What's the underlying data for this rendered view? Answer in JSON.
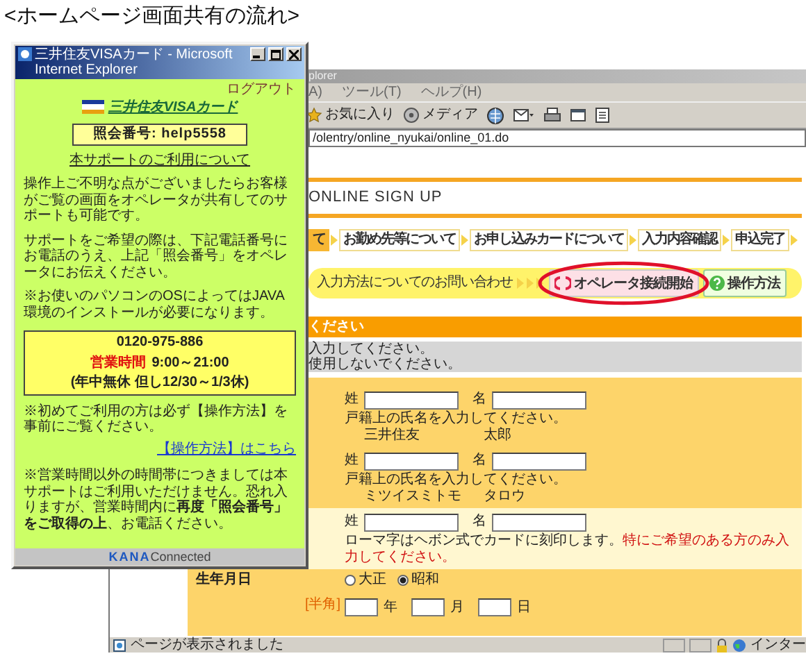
{
  "heading": "<ホームページ画面共有の流れ>",
  "back_window": {
    "title": "plorer",
    "menu": [
      "A)",
      "ツール(T)",
      "ヘルプ(H)"
    ],
    "toolbar": [
      {
        "kind": "favorites",
        "label": "お気に入り"
      },
      {
        "kind": "media",
        "label": "メディア"
      },
      {
        "kind": "history"
      },
      {
        "kind": "mail"
      },
      {
        "kind": "print"
      },
      {
        "kind": "edit"
      },
      {
        "kind": "discuss"
      }
    ],
    "address": "/olentry/online_nyukai/online_01.do",
    "page": {
      "heading": "ONLINE SIGN UP",
      "steps": [
        {
          "label": "て",
          "selected": true
        },
        {
          "label": "お勤め先等について",
          "selected": false
        },
        {
          "label": "お申し込みカードについて",
          "selected": false
        },
        {
          "label": "入力内容確認",
          "selected": false
        },
        {
          "label": "申込完了",
          "selected": false
        }
      ],
      "help_bar": {
        "label": "入力方法についてのお問い合わせ",
        "operator_button": {
          "label": "オペレータ接続開始",
          "highlighted": true
        },
        "guide_button": "操作方法"
      },
      "section_title": "ください",
      "notes": [
        "入力してください。",
        "使用しないでください。"
      ],
      "name_rows": [
        {
          "kind": "kanji",
          "surname_label": "姓",
          "given_label": "名",
          "hint": "戸籍上の氏名を入力してください。",
          "example_surname": "三井住友",
          "example_given": "太郎"
        },
        {
          "kind": "kana",
          "surname_label": "姓",
          "given_label": "名",
          "hint": "戸籍上の氏名を入力してください。",
          "example_surname": "ミツイスミトモ",
          "example_given": "タロウ"
        },
        {
          "kind": "romaji",
          "surname_label": "姓",
          "given_label": "名",
          "note": "ローマ字はヘボン式でカードに刻印します。",
          "warning": "特にご希望のある方のみ入力してください。"
        }
      ],
      "birth": {
        "label": "生年月日",
        "hint": "[半角]",
        "eras": [
          {
            "label": "大正",
            "selected": false
          },
          {
            "label": "昭和",
            "selected": true
          }
        ],
        "units": [
          "年",
          "月",
          "日"
        ]
      }
    },
    "status": {
      "text": "ページが表示されました",
      "zone": "インター"
    }
  },
  "front_window": {
    "title": "三井住友VISAカード - Microsoft Internet Explorer",
    "logout": "ログアウト",
    "brand": "三井住友VISAカード",
    "reference": "照会番号: help5558",
    "about_link": "本サポートのご利用について",
    "paragraphs": [
      "操作上ご不明な点がございましたらお客様がご覧の画面をオペレータが共有してのサポートも可能です。",
      "サポートをご希望の際は、下記電話番号にお電話のうえ、上記「照会番号」をオペレータにお伝えください。",
      "※お使いのパソコンのOSによってはJAVA環境のインストールが必要になります。"
    ],
    "contact": {
      "phone": "0120-975-886",
      "hours_label": "営業時間",
      "hours": "9:00～21:00",
      "closed": "(年中無休 但し12/30～1/3休)"
    },
    "first_time_note": "※初めてご利用の方は必ず【操作方法】を事前にご覧ください。",
    "guide_link": "【操作方法】はこちら",
    "after_hours_note": "※営業時間以外の時間帯につきましては本サポートはご利用いただけません。恐れ入りますが、営業時間内に**再度「照会番号」をご取得の上**、お電話ください。",
    "footer": {
      "brand": "KANA",
      "suffix": "Connected"
    }
  }
}
